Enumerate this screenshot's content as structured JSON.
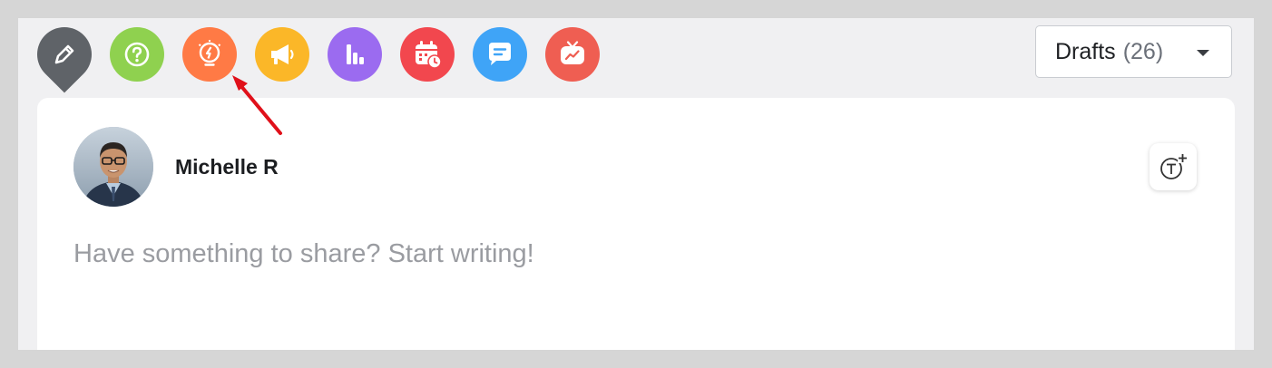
{
  "toolbar": {
    "buttons": [
      {
        "name": "write",
        "icon": "pencil-icon",
        "color": "#5f6368"
      },
      {
        "name": "question",
        "icon": "question-mark-icon",
        "color": "#8fd14f"
      },
      {
        "name": "idea",
        "icon": "lightbulb-icon",
        "color": "#ff7a45"
      },
      {
        "name": "announcement",
        "icon": "megaphone-icon",
        "color": "#fbb728"
      },
      {
        "name": "poll",
        "icon": "bar-chart-icon",
        "color": "#9b6bf0"
      },
      {
        "name": "event",
        "icon": "calendar-clock-icon",
        "color": "#f2474e"
      },
      {
        "name": "discussion",
        "icon": "chat-bubble-icon",
        "color": "#3fa4f7"
      },
      {
        "name": "live",
        "icon": "tv-trend-icon",
        "color": "#ef5e52"
      }
    ]
  },
  "drafts": {
    "label": "Drafts",
    "count": "(26)"
  },
  "post": {
    "author": "Michelle R",
    "placeholder": "Have something to share? Start writing!"
  },
  "colors": {
    "annotation_arrow": "#e0101a"
  }
}
